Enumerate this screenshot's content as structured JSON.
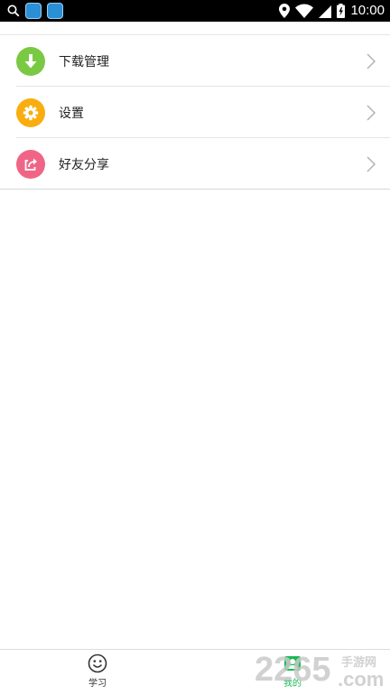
{
  "status_bar": {
    "time": "10:00"
  },
  "menu": {
    "items": [
      {
        "label": "下载管理",
        "icon": "download-icon",
        "color": "#7ac943"
      },
      {
        "label": "设置",
        "icon": "gear-icon",
        "color": "#f9ad0e"
      },
      {
        "label": "好友分享",
        "icon": "share-icon",
        "color": "#f06585"
      }
    ]
  },
  "tab_bar": {
    "tabs": [
      {
        "label": "学习",
        "icon": "smiley-icon",
        "active": false
      },
      {
        "label": "我的",
        "icon": "profile-icon",
        "active": true
      }
    ],
    "active_color": "#19b955"
  },
  "watermark": {
    "brand": "2265",
    "dot_com": ".com",
    "site_name": "手游网"
  }
}
